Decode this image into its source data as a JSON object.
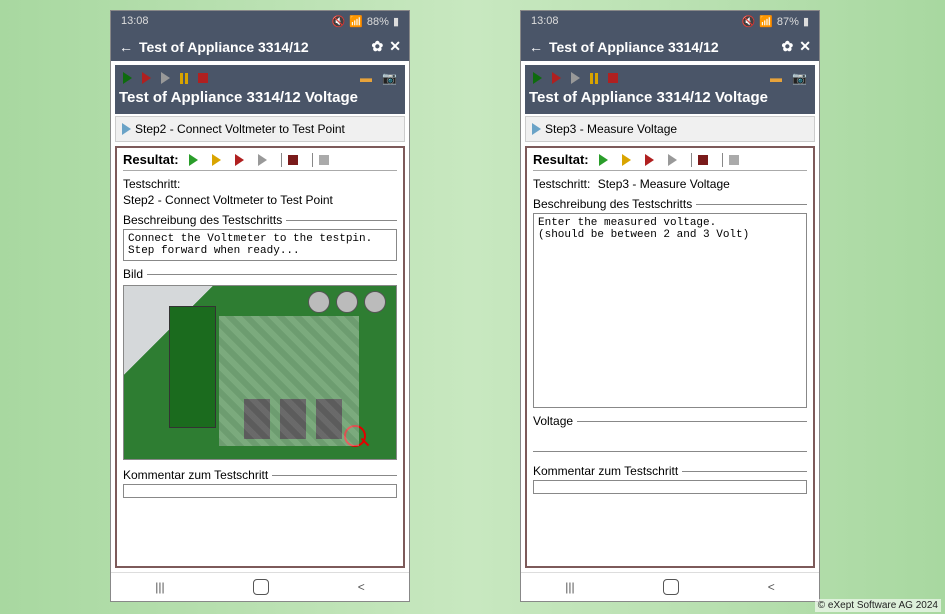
{
  "copyright": "© eXept Software AG 2024",
  "phones": [
    {
      "status": {
        "time": "13:08",
        "battery": "88%"
      },
      "appbar_title": "Test of Appliance 3314/12",
      "toolbar_title": "Test of Appliance 3314/12 Voltage",
      "step_label": "Step2 - Connect Voltmeter to Test Point",
      "resultat_label": "Resultat:",
      "testschritt_label": "Testschritt:",
      "testschritt_value": "Step2 - Connect Voltmeter to Test Point",
      "desc_legend": "Beschreibung des Testschritts",
      "desc_text": "Connect the Voltmeter to the testpin.\nStep forward when ready...",
      "bild_legend": "Bild",
      "kommentar_legend": "Kommentar zum Testschritt",
      "show_image": true,
      "show_voltage": false
    },
    {
      "status": {
        "time": "13:08",
        "battery": "87%"
      },
      "appbar_title": "Test of Appliance 3314/12",
      "toolbar_title": "Test of Appliance 3314/12 Voltage",
      "step_label": "Step3 - Measure Voltage",
      "resultat_label": "Resultat:",
      "testschritt_label": "Testschritt:",
      "testschritt_value": "Step3 - Measure Voltage",
      "desc_legend": "Beschreibung des Testschritts",
      "desc_text": "Enter the measured voltage.\n(should be between 2 and 3 Volt)",
      "voltage_legend": "Voltage",
      "kommentar_legend": "Kommentar zum Testschritt",
      "show_image": false,
      "show_voltage": true
    }
  ]
}
